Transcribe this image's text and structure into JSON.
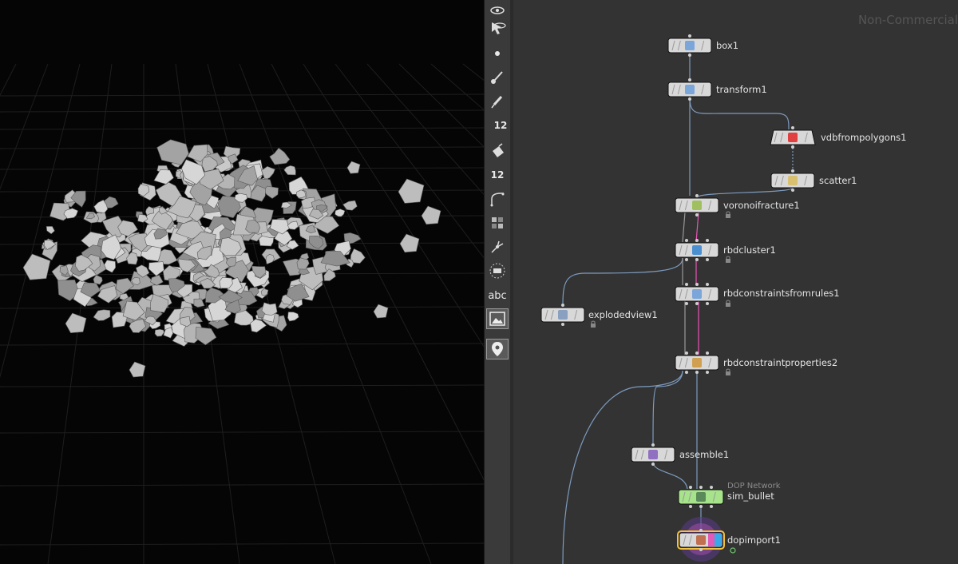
{
  "toolbar": {
    "number_badge_1": "12",
    "number_badge_2": "12",
    "text_tool": "abc"
  },
  "network": {
    "watermark": "Non-Commercial",
    "nodes": {
      "box1": "box1",
      "transform1": "transform1",
      "vdbfrompolygons1": "vdbfrompolygons1",
      "scatter1": "scatter1",
      "voronoifracture1": "voronoifracture1",
      "rbdcluster1": "rbdcluster1",
      "rbdconstraintsfromrules1": "rbdconstraintsfromrules1",
      "explodedview1": "explodedview1",
      "rbdconstraintproperties2": "rbdconstraintproperties2",
      "assemble1": "assemble1",
      "sim_bullet": "sim_bullet",
      "sim_bullet_type": "DOP Network",
      "dopimport1": "dopimport1"
    },
    "colors": {
      "background": "#333333",
      "node": "#d8d8d8",
      "dop_node": "#a6e38a",
      "wire": "#7d9bbf",
      "constraint_wire": "#e855b6",
      "selected": "#f2c23a"
    }
  }
}
